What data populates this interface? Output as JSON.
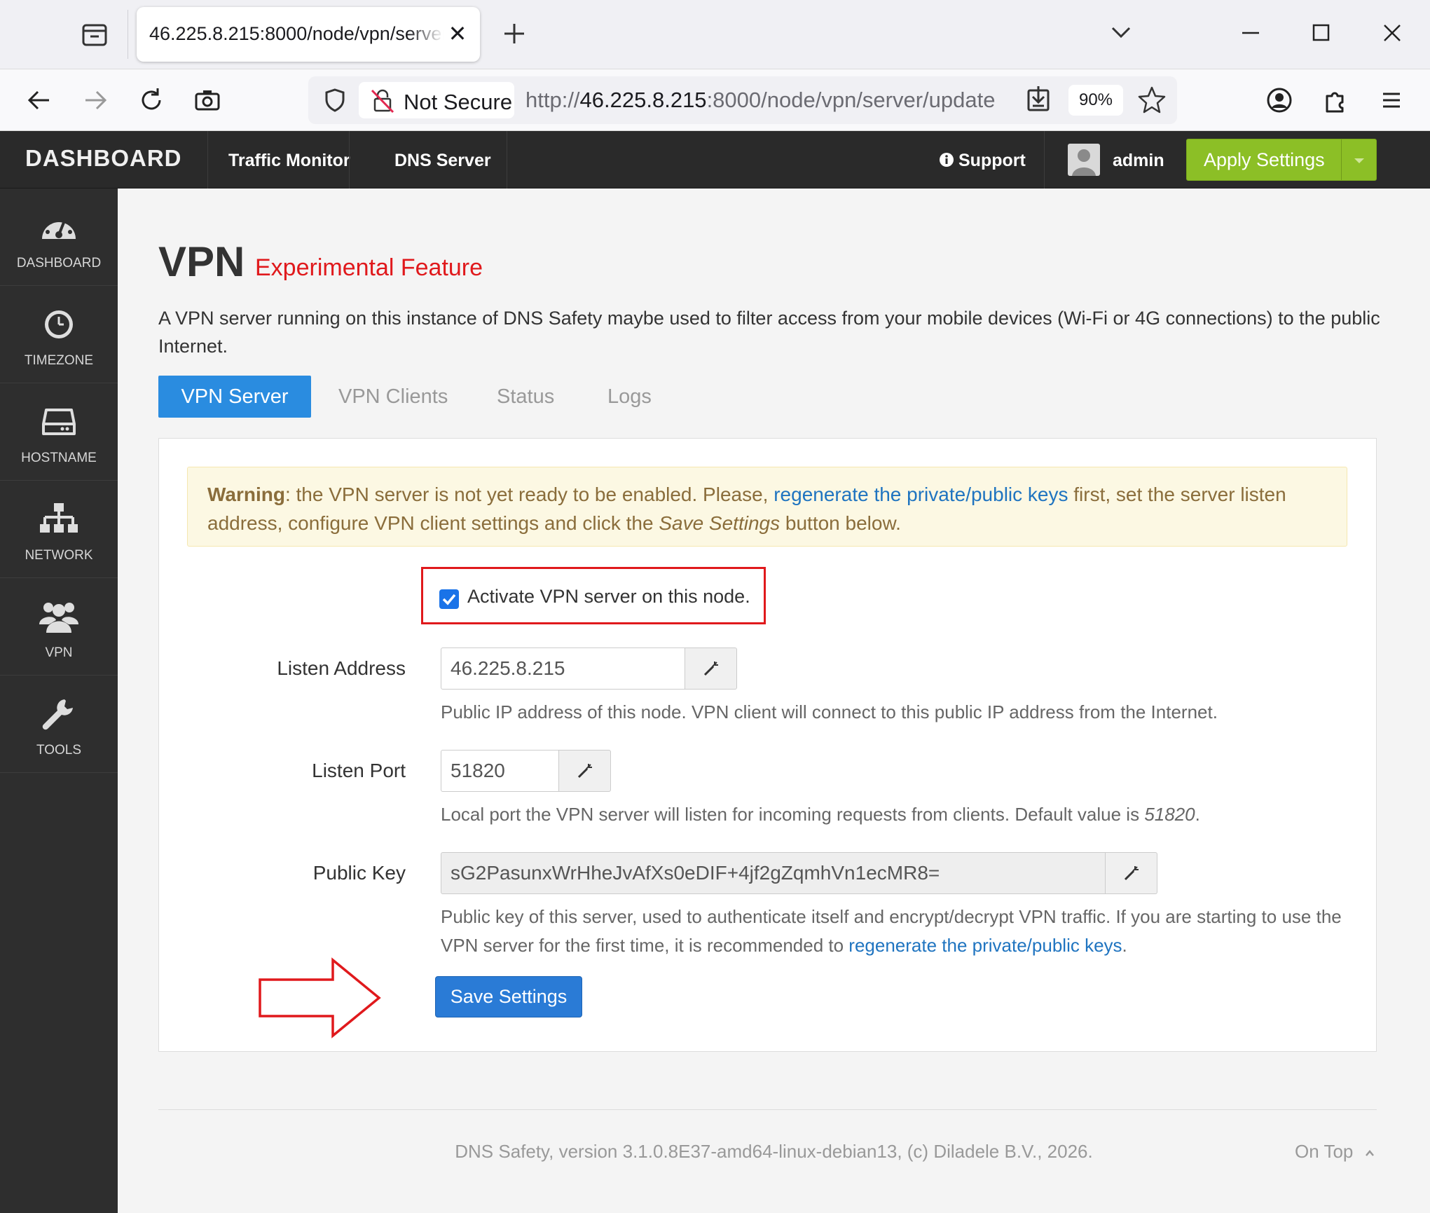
{
  "browser": {
    "tab_title": "46.225.8.215:8000/node/vpn/server/update",
    "not_secure_label": "Not Secure",
    "url_prefix": "http://",
    "url_host": "46.225.8.215",
    "url_rest": ":8000/node/vpn/server/update",
    "zoom": "90%"
  },
  "appnav": {
    "brand": "DASHBOARD",
    "links": [
      "Traffic Monitor",
      "DNS Server"
    ],
    "support": "Support",
    "user": "admin",
    "apply_label": "Apply Settings",
    "accent": "#8cbf26"
  },
  "sidebar": {
    "items": [
      {
        "label": "DASHBOARD",
        "icon": "gauge-icon"
      },
      {
        "label": "TIMEZONE",
        "icon": "clock-icon"
      },
      {
        "label": "HOSTNAME",
        "icon": "server-drive-icon"
      },
      {
        "label": "NETWORK",
        "icon": "network-tree-icon"
      },
      {
        "label": "VPN",
        "icon": "users-icon"
      },
      {
        "label": "TOOLS",
        "icon": "wrench-icon"
      }
    ]
  },
  "page": {
    "title": "VPN",
    "subtitle": "Experimental Feature",
    "intro": "A VPN server running on this instance of DNS Safety maybe used to filter access from your mobile devices (Wi-Fi or 4G connections) to the public Internet.",
    "tabs": [
      "VPN Server",
      "VPN Clients",
      "Status",
      "Logs"
    ]
  },
  "warning": {
    "strong": "Warning",
    "text1": ": the VPN server is not yet ready to be enabled. Please, ",
    "link": "regenerate the private/public keys",
    "text2": " first, set the server listen address, configure VPN client settings and click the ",
    "em": "Save Settings",
    "text3": " button below."
  },
  "form": {
    "activate_label": "Activate VPN server on this node.",
    "activate_checked": true,
    "listen_address": {
      "label": "Listen Address",
      "value": "46.225.8.215",
      "help": "Public IP address of this node. VPN client will connect to this public IP address from the Internet."
    },
    "listen_port": {
      "label": "Listen Port",
      "value": "51820",
      "help": "Local port the VPN server will listen for incoming requests from clients. Default value is ",
      "help_em": "51820",
      "help_end": "."
    },
    "public_key": {
      "label": "Public Key",
      "value": "sG2PasunxWrHheJvAfXs0eDIF+4jf2gZqmhVn1ecMR8=",
      "help": "Public key of this server, used to authenticate itself and encrypt/decrypt VPN traffic. If you are starting to use the VPN server for the first time, it is recommended to ",
      "help_link": "regenerate the private/public keys",
      "help_end": "."
    },
    "save_label": "Save Settings"
  },
  "footer": {
    "text": "DNS Safety, version 3.1.0.8E37-amd64-linux-debian13, (c) Diladele B.V., 2026.",
    "on_top": "On Top"
  }
}
